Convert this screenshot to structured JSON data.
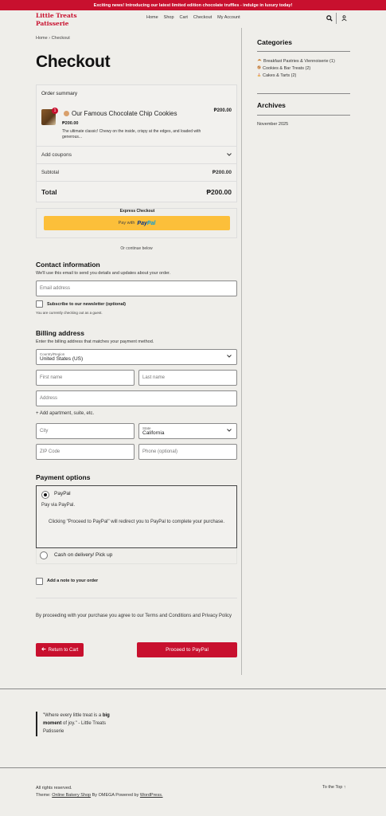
{
  "announcement": "Exciting news! Introducing our latest limited edition chocolate truffles - indulge in luxury today!",
  "brand": {
    "line1": "Little Treats",
    "line2": "Patisserie",
    "color": "#c8102e"
  },
  "nav": [
    "Home",
    "Shop",
    "Cart",
    "Checkout",
    "My Account"
  ],
  "header_icons": [
    "search-icon",
    "user-icon"
  ],
  "breadcrumb": {
    "home": "Home",
    "sep": "›",
    "current": "Checkout"
  },
  "page_title": "Checkout",
  "order_summary": {
    "title": "Order summary",
    "item": {
      "quantity": "1",
      "name": "Our Famous Chocolate Chip Cookies",
      "total": "₱200.00",
      "unit_price": "₱200.00",
      "description": "The ultimate classic! Chewy on the inside, crispy at the edges, and loaded with generous..."
    },
    "coupons_label": "Add coupons",
    "subtotal_label": "Subtotal",
    "subtotal_value": "₱200.00",
    "total_label": "Total",
    "total_value": "₱200.00"
  },
  "express": {
    "title": "Express Checkout",
    "pay_with": "Pay with",
    "paypal_a": "Pay",
    "paypal_b": "Pal",
    "button_color": "#fcbf3a"
  },
  "or_continue": "Or continue below",
  "contact": {
    "title": "Contact information",
    "description": "We'll use this email to send you details and updates about your order.",
    "email_placeholder": "Email address",
    "newsletter_label": "Subscribe to our newsletter (optional)",
    "guest_note": "You are currently checking out as a guest."
  },
  "billing": {
    "title": "Billing address",
    "description": "Enter the billing address that matches your payment method.",
    "country_label": "Country/Region",
    "country_value": "United States (US)",
    "first_name": "First name",
    "last_name": "Last name",
    "address": "Address",
    "add_apartment": "+ Add apartment, suite, etc.",
    "city": "City",
    "state_label": "State",
    "state_value": "California",
    "zip": "ZIP Code",
    "phone": "Phone (optional)"
  },
  "payment": {
    "title": "Payment options",
    "paypal_label": "PayPal",
    "paypal_desc": "Pay via PayPal.",
    "paypal_note": "Clicking \"Proceed to PayPal\" will redirect you to PayPal to complete your purchase.",
    "cod_label": "Cash on delivery/ Pick up"
  },
  "order_note_label": "Add a note to your order",
  "terms": "By proceeding with your purchase you agree to our Terms and Conditions and Privacy Policy",
  "buttons": {
    "return": "Return to Cart",
    "proceed": "Proceed to PayPal"
  },
  "sidebar": {
    "categories_title": "Categories",
    "categories": [
      {
        "label": "Breakfast Pastries & Viennoiserie (1)",
        "icon": "croissant-icon"
      },
      {
        "label": "Cookies & Bar Treats (2)",
        "icon": "cookie-icon"
      },
      {
        "label": "Cakes & Tarts (2)",
        "icon": "cake-icon"
      }
    ],
    "archives_title": "Archives",
    "archives": [
      "November 2025"
    ]
  },
  "footer": {
    "quote_start": "\"Where every little treat is a ",
    "quote_bold": "big moment",
    "quote_end": " of joy.\" - Little Treats Patisserie",
    "rights": "All rights reserved.",
    "theme_prefix": "Theme:",
    "theme_link": "Online Bakery Shop",
    "by_omega": "By OMEGA Powered by",
    "wordpress": "WordPress.",
    "to_top": "To the Top ↑"
  }
}
